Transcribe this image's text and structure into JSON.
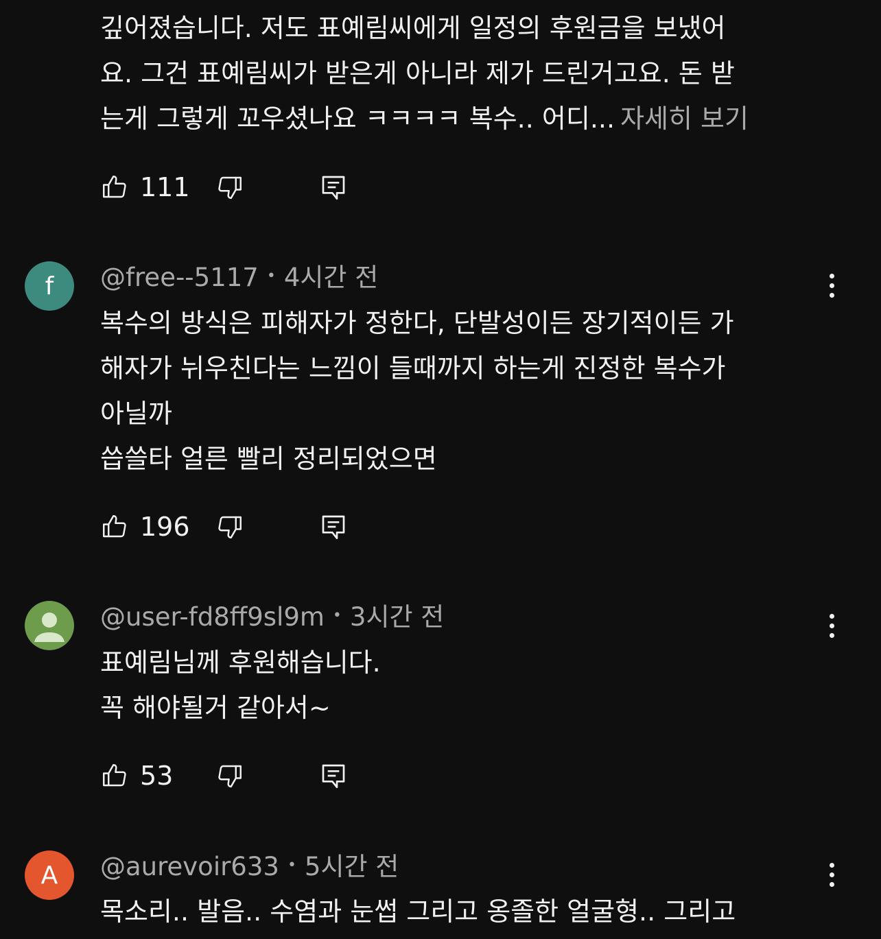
{
  "comments": [
    {
      "text_lines": [
        "깊어졌습니다. 저도 표예림씨에게 일정의 후원금을 보냈어",
        "요. 그건 표예림씨가 받은게 아니라 제가 드린거고요.  돈 받",
        "는게 그렇게 꼬우셨나요 ㅋㅋㅋㅋ 복수.. 어디..."
      ],
      "more_label": "자세히 보기",
      "likes": "111"
    },
    {
      "avatar_letter": "f",
      "avatar_color": "#3d8a7e",
      "username": "@free--5117",
      "time": "4시간 전",
      "text_lines": [
        "복수의 방식은 피해자가 정한다, 단발성이든 장기적이든 가",
        "해자가 뉘우친다는 느낌이 들때까지 하는게 진정한 복수가",
        "아닐까",
        "씁쓸타 얼른 빨리 정리되었으면"
      ],
      "likes": "196"
    },
    {
      "avatar_icon": "default-user-icon",
      "avatar_color": "#6d9c4d",
      "username": "@user-fd8ff9sl9m",
      "time": "3시간 전",
      "text_lines": [
        "표예림님께 후원해습니다.",
        "꼭 해야될거 같아서~"
      ],
      "likes": "53"
    },
    {
      "avatar_letter": "A",
      "avatar_color": "#e4572e",
      "username": "@aurevoir633",
      "time": "5시간 전",
      "text_lines": [
        "목소리.. 발음.. 수염과 눈썹 그리고 옹졸한 얼굴형.. 그리고"
      ]
    }
  ],
  "separator": "•",
  "icons": {
    "like": "thumbs-up-icon",
    "dislike": "thumbs-down-icon",
    "reply": "reply-comment-icon",
    "menu": "more-vertical-icon"
  }
}
